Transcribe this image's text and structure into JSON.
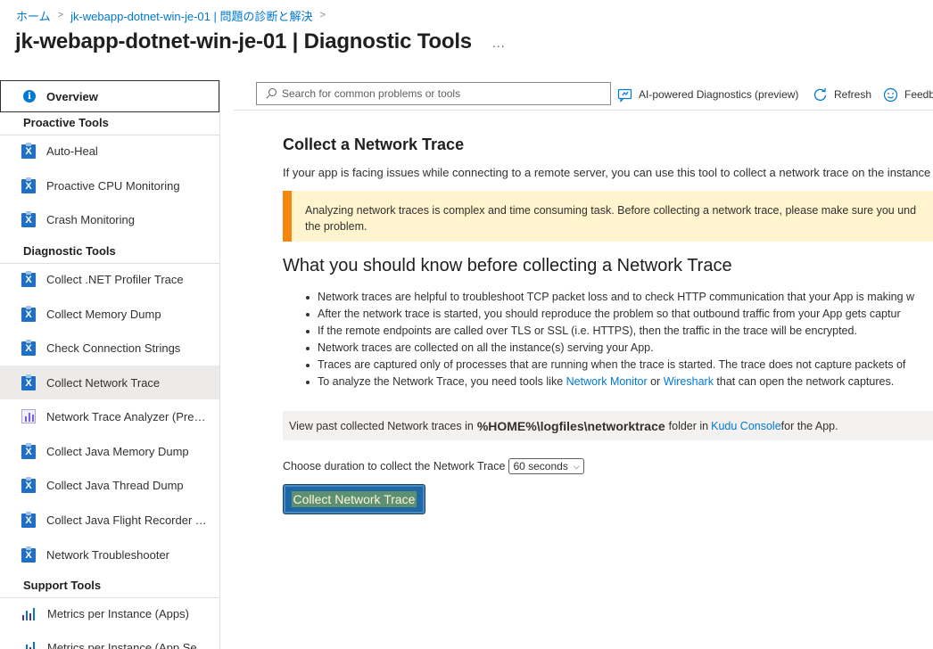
{
  "breadcrumb": {
    "home": "ホーム",
    "current": "jk-webapp-dotnet-win-je-01 | 問題の診断と解決"
  },
  "page": {
    "title": "jk-webapp-dotnet-win-je-01 | Diagnostic Tools",
    "more": "..."
  },
  "sidebar": {
    "overview": "Overview",
    "sections": {
      "proactive": "Proactive Tools",
      "diagnostic": "Diagnostic Tools",
      "support": "Support Tools"
    },
    "proactive_items": [
      {
        "label": "Auto-Heal"
      },
      {
        "label": "Proactive CPU Monitoring"
      },
      {
        "label": "Crash Monitoring"
      }
    ],
    "diagnostic_items": [
      {
        "label": "Collect .NET Profiler Trace"
      },
      {
        "label": "Collect Memory Dump"
      },
      {
        "label": "Check Connection Strings"
      },
      {
        "label": "Collect Network Trace",
        "active": true
      },
      {
        "label": "Network Trace Analyzer (Preview)"
      },
      {
        "label": "Collect Java Memory Dump"
      },
      {
        "label": "Collect Java Thread Dump"
      },
      {
        "label": "Collect Java Flight Recorder Trace"
      },
      {
        "label": "Network Troubleshooter"
      }
    ],
    "support_items": [
      {
        "label": "Metrics per Instance (Apps)"
      },
      {
        "label": "Metrics per Instance (App Service Plan)"
      }
    ]
  },
  "toolbar": {
    "search_placeholder": "Search for common problems or tools",
    "ai_label": "AI-powered Diagnostics (preview)",
    "refresh_label": "Refresh",
    "feedback_label": "Feedback"
  },
  "main": {
    "heading": "Collect a Network Trace",
    "intro": "If your app is facing issues while connecting to a remote server, you can use this tool to collect a network trace on the instance",
    "warning_line1": "Analyzing network traces is complex and time consuming task. Before collecting a network trace, please make sure you und",
    "warning_line2": "the problem.",
    "subheading": "What you should know before collecting a Network Trace",
    "bullets": [
      "Network traces are helpful to troubleshoot TCP packet loss and to check HTTP communication that your App is making w",
      "After the network trace is started, you should reproduce the problem so that outbound traffic from your App gets captur",
      "If the remote endpoints are called over TLS or SSL (i.e. HTTPS), then the traffic in the trace will be encrypted.",
      "Network traces are collected on all the instance(s) serving your App.",
      "Traces are captured only of processes that are running when the trace is started. The trace does not capture packets of"
    ],
    "analyze": {
      "prefix": "To analyze the Network Trace, you need tools like ",
      "link1": "Network Monitor",
      "mid": " or ",
      "link2": "Wireshark",
      "suffix": " that can open the network captures."
    },
    "kudu": {
      "prefix": "View past collected Network traces in",
      "path": "%HOME%\\logfiles\\networktrace",
      "mid": "folder in ",
      "link": "Kudu Console",
      "suffix": " for the App."
    },
    "duration_label": "Choose duration to collect the Network Trace",
    "duration_value": "60 seconds",
    "collect_button": "Collect Network Trace"
  },
  "colors": {
    "accent": "#0078d4",
    "warning_bar": "#f7860f",
    "warning_bg": "#fff4ce",
    "button_bg": "#1f68a8"
  }
}
